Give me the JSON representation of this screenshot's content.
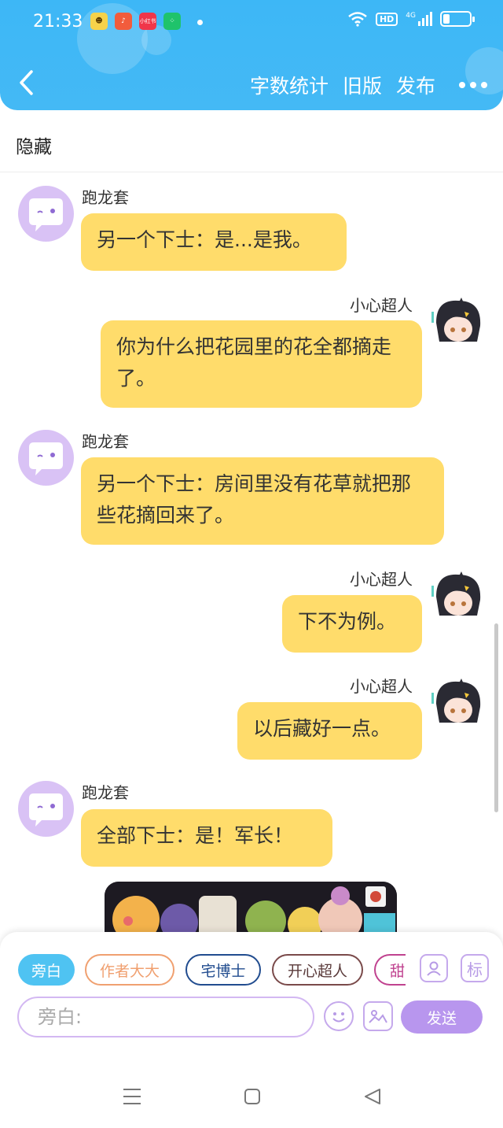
{
  "status_bar": {
    "time": "21:33",
    "apps": [
      {
        "name": "app-yellow",
        "color": "#f7d24a",
        "glyph": "☻"
      },
      {
        "name": "music",
        "color": "#f25c3c",
        "glyph": "♪"
      },
      {
        "name": "xiaohongshu",
        "color": "#f0364a",
        "glyph": "小红书"
      },
      {
        "name": "app-green",
        "color": "#1fc36b",
        "glyph": "⁘"
      }
    ],
    "network_hd": "HD",
    "network_gen": "4G",
    "battery_level": 0.25
  },
  "header": {
    "actions": [
      "字数统计",
      "旧版",
      "发布"
    ]
  },
  "subbar": {
    "label": "隐藏"
  },
  "messages": [
    {
      "side": "left",
      "name": "跑龙套",
      "text": "另一个下士：是...是我。"
    },
    {
      "side": "right",
      "name": "小心超人",
      "text": "你为什么把花园里的花全都摘走了。"
    },
    {
      "side": "left",
      "name": "跑龙套",
      "text": "另一个下士：房间里没有花草就把那些花摘回来了。"
    },
    {
      "side": "right",
      "name": "小心超人",
      "text": "下不为例。"
    },
    {
      "side": "right",
      "name": "小心超人",
      "text": "以后藏好一点。"
    },
    {
      "side": "left",
      "name": "跑龙套",
      "text": "全部下士：是！军长！"
    }
  ],
  "input_panel": {
    "chips": [
      {
        "label": "旁白",
        "style": "selected",
        "color": "#4fc3f2"
      },
      {
        "label": "作者大大",
        "style": "outline",
        "color": "#f0a070"
      },
      {
        "label": "宅博士",
        "style": "outline",
        "color": "#214c8f"
      },
      {
        "label": "开心超人",
        "style": "outline",
        "color": "#7a4a4a"
      },
      {
        "label": "甜",
        "style": "outline",
        "color": "#c0428f"
      }
    ],
    "tag_button": "标",
    "placeholder": "旁白:",
    "send_label": "发送"
  },
  "colors": {
    "header_blue": "#3db7f6",
    "bubble_yellow": "#ffdc6b",
    "accent_purple": "#b896ee"
  }
}
